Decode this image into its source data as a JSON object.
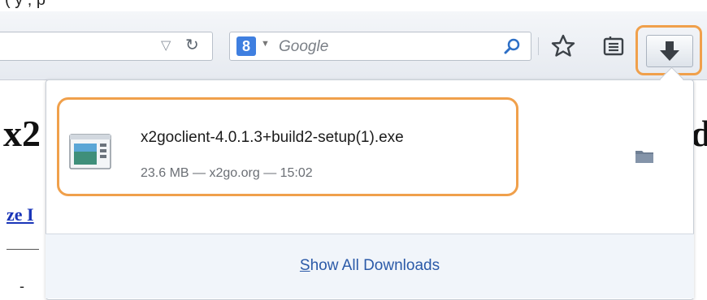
{
  "top_strip": {
    "text": "(                                              y                              ,           p"
  },
  "toolbar": {
    "search": {
      "placeholder": "Google",
      "engine_letter": "8"
    },
    "icons": {
      "url_dropdown": "dropdown-triangle-icon",
      "reload": "reload-icon",
      "search_go": "magnifier-icon",
      "bookmark": "star-icon",
      "reading_list": "reading-list-icon",
      "downloads": "download-arrow-icon"
    }
  },
  "page": {
    "heading_left": "x2",
    "heading_right": "d",
    "link_text": "ze I",
    "dash": "-"
  },
  "downloads_panel": {
    "items": [
      {
        "filename": "x2goclient-4.0.1.3+build2-setup(1).exe",
        "meta": "23.6 MB — x2go.org — 15:02"
      }
    ],
    "footer": {
      "show_all_accel": "S",
      "show_all_rest": "how All Downloads"
    }
  },
  "colors": {
    "highlight": "#f0a04b",
    "link": "#2b5aa8",
    "footer_bg": "#f1f5fa"
  }
}
